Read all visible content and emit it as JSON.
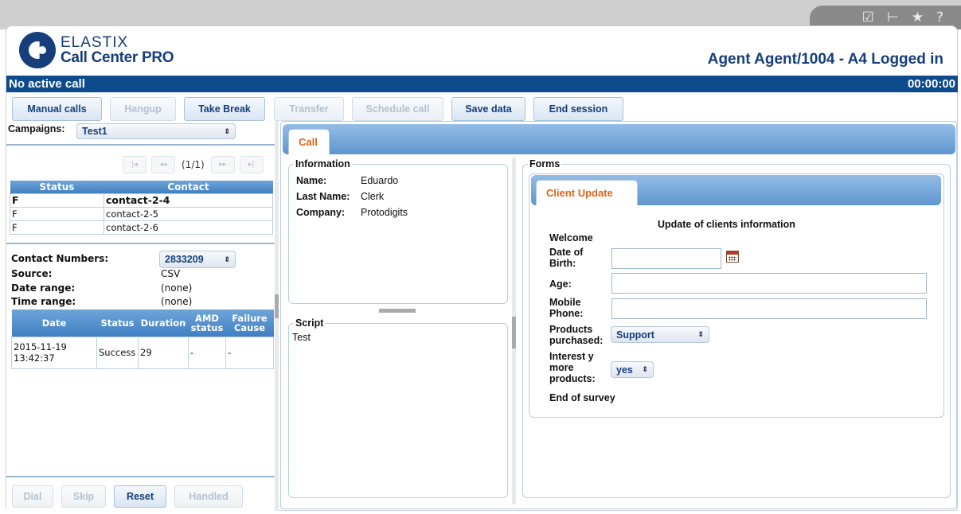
{
  "toolbar_icons": [
    "edit-icon",
    "step-forward-icon",
    "star-icon",
    "help-icon"
  ],
  "toolbar_icon_glyphs": [
    "☑",
    "⊢",
    "★",
    "?"
  ],
  "brand": {
    "line1": "ELASTIX",
    "line2": "Call Center PRO"
  },
  "agent_status": "Agent Agent/1004 - A4 Logged in",
  "call_bar": {
    "status": "No active call",
    "timer": "00:00:00"
  },
  "actions": {
    "manual_calls": "Manual calls",
    "hangup": "Hangup",
    "take_break": "Take Break",
    "transfer": "Transfer",
    "schedule_call": "Schedule call",
    "save_data": "Save data",
    "end_session": "End session"
  },
  "campaigns": {
    "label": "Campaigns:",
    "selected": "Test1"
  },
  "pager": {
    "first": "|◂",
    "prev": "◂◂",
    "text": "(1/1)",
    "next": "▸▸",
    "last": "▸|"
  },
  "contacts_table": {
    "headers": [
      "Status",
      "Contact"
    ],
    "rows": [
      {
        "status": "F",
        "contact": "contact-2-4"
      },
      {
        "status": "F",
        "contact": "contact-2-5"
      },
      {
        "status": "F",
        "contact": "contact-2-6"
      }
    ]
  },
  "contact_info": {
    "numbers_label": "Contact Numbers:",
    "numbers_selected": "2833209",
    "source_label": "Source:",
    "source_value": "CSV",
    "date_range_label": "Date range:",
    "date_range_value": "(none)",
    "time_range_label": "Time range:",
    "time_range_value": "(none)"
  },
  "history_table": {
    "headers": {
      "date": "Date",
      "status": "Status",
      "duration": "Duration",
      "amd": "AMD status",
      "failure": "Failure Cause"
    },
    "rows": [
      {
        "date": "2015-11-19 13:42:37",
        "status": "Success",
        "duration": "29",
        "amd": "-",
        "failure": "-"
      }
    ]
  },
  "bottom_actions": {
    "dial": "Dial",
    "skip": "Skip",
    "reset": "Reset",
    "handled": "Handled"
  },
  "call_tab": "Call",
  "information": {
    "legend": "Information",
    "name_label": "Name:",
    "name_value": "Eduardo",
    "last_name_label": "Last Name:",
    "last_name_value": "Clerk",
    "company_label": "Company:",
    "company_value": "Protodigits"
  },
  "script": {
    "legend": "Script",
    "text": "Test"
  },
  "forms": {
    "legend": "Forms",
    "tab": "Client Update",
    "title": "Update of clients information",
    "welcome": "Welcome",
    "dob_label_1": "Date of",
    "dob_label_2": "Birth:",
    "age_label": "Age:",
    "mobile_label_1": "Mobile",
    "mobile_label_2": "Phone:",
    "products_label_1": "Products",
    "products_label_2": "purchased:",
    "products_selected": "Support",
    "interest_label_1": "Interest y",
    "interest_label_2": "more",
    "interest_label_3": "products:",
    "interest_selected": "yes",
    "end": "End of survey"
  },
  "select_arrow": "⇕"
}
